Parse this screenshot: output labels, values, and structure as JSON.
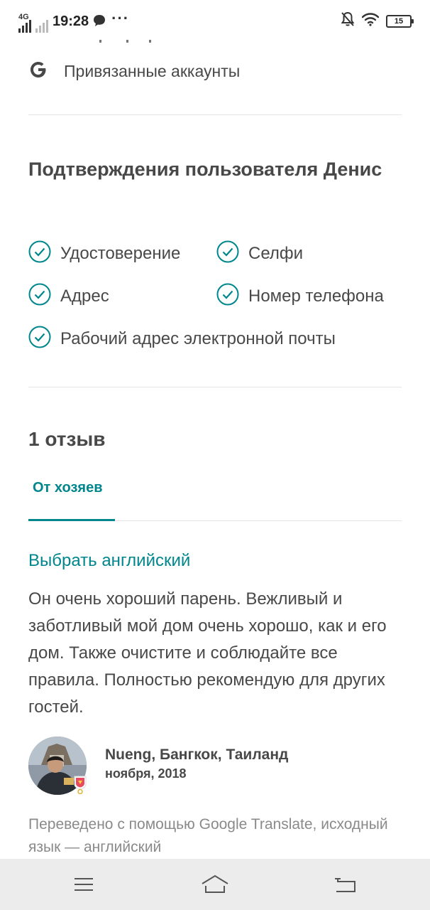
{
  "status_bar": {
    "network": "4G",
    "time": "19:28",
    "more": "···",
    "battery": "15"
  },
  "linked_accounts": {
    "label": "Привязанные аккаунты"
  },
  "verifications": {
    "title": "Подтверждения пользователя Денис",
    "items": [
      "Удостоверение",
      "Селфи",
      "Адрес",
      "Номер телефона",
      "Рабочий адрес электронной почты"
    ]
  },
  "reviews": {
    "count_label": "1 отзыв",
    "tabs": [
      {
        "label": "От хозяев",
        "selected": true
      }
    ],
    "translate_link": "Выбрать английский",
    "text": "Он очень хороший парень. Вежливый и заботливый мой дом очень хорошо, как и его дом. Также очистите и соблюдайте все правила. Полностью рекомендую для других гостей.",
    "reviewer": {
      "name": "Nueng, Бангкок, Таиланд",
      "date": "ноября, 2018"
    },
    "translated_note": "Переведено с помощью Google Translate, исходный язык — английский"
  },
  "colors": {
    "accent": "#00868d",
    "text": "#484848",
    "muted": "#8a8a8a"
  },
  "icons": {
    "linked": "google-icon",
    "verified": "check-circle-icon",
    "nav": [
      "menu-icon",
      "home-icon",
      "back-icon"
    ]
  }
}
